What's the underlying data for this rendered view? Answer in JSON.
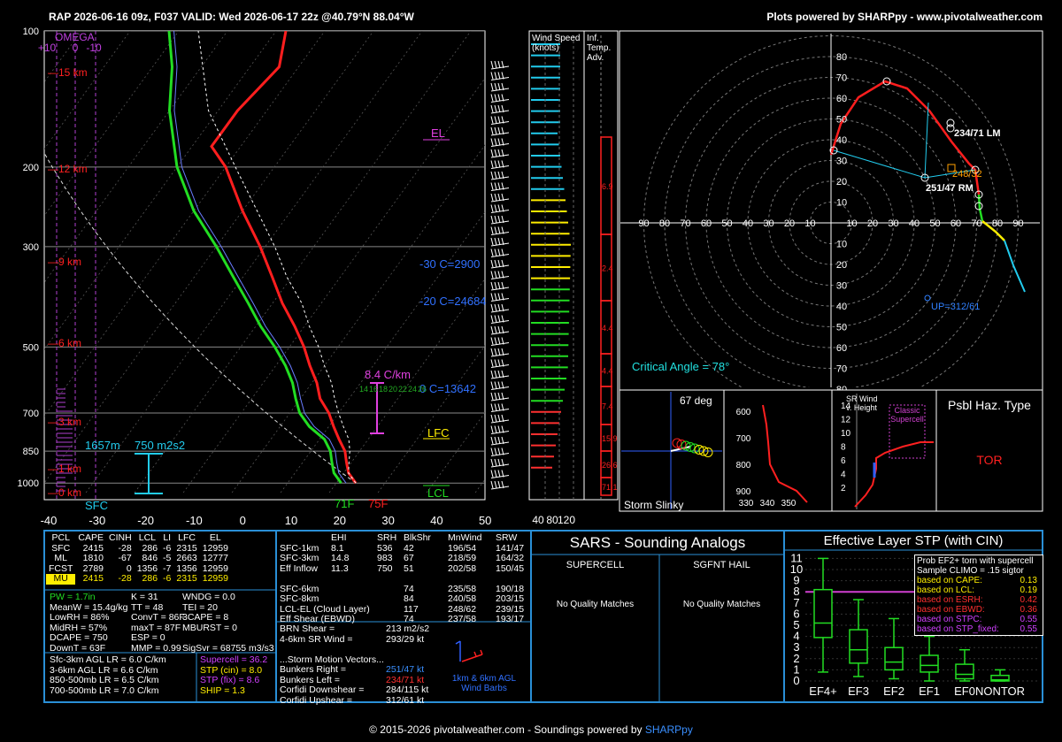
{
  "header": {
    "left": "RAP 2026-06-16 09z, F037  VALID: Wed 2026-06-17 22z @40.79°N 88.04°W",
    "right": "Plots powered by SHARPpy - www.pivotalweather.com"
  },
  "footer": {
    "text": "© 2015-2026 pivotalweather.com - Soundings powered by ",
    "link": "SHARPpy"
  },
  "skewt": {
    "pressure_ticks": [
      "100",
      "200",
      "300",
      "500",
      "700",
      "850",
      "1000"
    ],
    "temp_ticks": [
      "-40",
      "-30",
      "-20",
      "-10",
      "0",
      "10",
      "20",
      "30",
      "40",
      "50"
    ],
    "height_labels": [
      "15 km",
      "12 km",
      "9 km",
      "6 km",
      "3 km",
      "1 km",
      "0 km"
    ],
    "omega_label": "OMEGA",
    "omega_ticks": [
      "+10",
      "0",
      "-10"
    ],
    "el_label": "EL",
    "lfc_label": "LFC",
    "lcl_label": "LCL",
    "lapse_label": "8.4 C/km",
    "hgz_labels": [
      "-30 C=2900",
      "-20 C=24684",
      "0 C=13642"
    ],
    "srh_depth": "1657m",
    "srh_value": "750 m2s2",
    "sfc_label": "SFC",
    "td_sfc": "71F",
    "t_sfc": "75F",
    "wetbulb_ticks": [
      "14",
      "16",
      "18",
      "20",
      "22",
      "24",
      "26"
    ]
  },
  "chart_data": [
    {
      "type": "line",
      "title": "",
      "xlabel": "",
      "ylabel": "",
      "ylim": [
        1000,
        100
      ],
      "xlim": [
        -40,
        50
      ],
      "series": [
        {
          "name": "",
          "color": "#ff1e1e",
          "points": [
            [
              1000,
              24
            ],
            [
              950,
              21
            ],
            [
              900,
              19
            ],
            [
              850,
              17
            ],
            [
              800,
              14
            ],
            [
              750,
              11
            ],
            [
              700,
              8
            ],
            [
              650,
              4
            ],
            [
              600,
              1
            ],
            [
              550,
              -3
            ],
            [
              500,
              -7
            ],
            [
              450,
              -12
            ],
            [
              400,
              -18
            ],
            [
              350,
              -24
            ],
            [
              300,
              -31
            ],
            [
              250,
              -40
            ],
            [
              200,
              -50
            ],
            [
              180,
              -56
            ],
            [
              150,
              -56
            ],
            [
              120,
              -54
            ],
            [
              100,
              -58
            ]
          ]
        },
        {
          "name": "",
          "color": "#22dd22",
          "points": [
            [
              1000,
              21
            ],
            [
              950,
              18
            ],
            [
              900,
              16
            ],
            [
              850,
              14
            ],
            [
              800,
              11
            ],
            [
              750,
              6
            ],
            [
              700,
              2
            ],
            [
              650,
              -1
            ],
            [
              600,
              -4
            ],
            [
              550,
              -8
            ],
            [
              500,
              -13
            ],
            [
              450,
              -19
            ],
            [
              400,
              -25
            ],
            [
              350,
              -32
            ],
            [
              300,
              -40
            ],
            [
              250,
              -50
            ],
            [
              200,
              -60
            ],
            [
              150,
              -70
            ],
            [
              120,
              -76
            ],
            [
              100,
              -82
            ]
          ]
        },
        {
          "name": "",
          "color": "#ffffff",
          "points": [
            [
              1000,
              24
            ],
            [
              950,
              21
            ],
            [
              900,
              19.5
            ],
            [
              850,
              18
            ],
            [
              800,
              16
            ],
            [
              750,
              13
            ],
            [
              700,
              10
            ],
            [
              650,
              7
            ],
            [
              600,
              4
            ],
            [
              550,
              0
            ],
            [
              500,
              -4
            ],
            [
              450,
              -9
            ],
            [
              400,
              -14
            ],
            [
              350,
              -21
            ],
            [
              300,
              -28
            ],
            [
              250,
              -37
            ],
            [
              200,
              -48
            ],
            [
              150,
              -62
            ],
            [
              100,
              -76
            ]
          ]
        }
      ]
    },
    {
      "type": "scatter",
      "title": "",
      "series": [
        {
          "name": "hodograph",
          "color": "#ff1e1e",
          "points": [
            [
              -4,
              2
            ],
            [
              0,
              4
            ],
            [
              4,
              6
            ],
            [
              8,
              10
            ],
            [
              12,
              16
            ],
            [
              20,
              25
            ],
            [
              28,
              32
            ],
            [
              36,
              38
            ],
            [
              46,
              42
            ],
            [
              56,
              42
            ],
            [
              63,
              40
            ],
            [
              66,
              33
            ],
            [
              68,
              27
            ],
            [
              70,
              22
            ],
            [
              70,
              18
            ]
          ]
        }
      ],
      "labels": [
        "234/71 LM",
        "251/47 RM",
        "248/32",
        "UP=312/61"
      ],
      "ring_labels": [
        "10",
        "20",
        "30",
        "40",
        "50",
        "60",
        "70",
        "80",
        "90"
      ],
      "critical_angle": "Critical Angle = 78°"
    }
  ],
  "wind_panel": {
    "title": "Wind Speed (knots)",
    "inf_title": "Inf. Temp. Adv.",
    "speed_ticks": [
      "40",
      "80",
      "120"
    ],
    "adv_labels": [
      "6.9",
      "2.4",
      "4.4",
      "4.4",
      "7.4",
      "15.9",
      "26.6",
      "71.1"
    ]
  },
  "storm_slinky": {
    "title": "Storm Slinky",
    "deg": "67 deg"
  },
  "theta_panel": {
    "p_ticks": [
      "600",
      "700",
      "800",
      "900"
    ],
    "t_ticks": [
      "330",
      "340",
      "350"
    ]
  },
  "srwind_panel": {
    "title": "SR Wind v. Height",
    "label": "Classic Supercell",
    "ticks": [
      "14",
      "12",
      "10",
      "8",
      "6",
      "4",
      "2"
    ]
  },
  "hazard": {
    "title": "Psbl Haz. Type",
    "value": "TOR"
  },
  "params": {
    "headers": [
      "PCL",
      "CAPE",
      "CINH",
      "LCL",
      "LI",
      "LFC",
      "EL"
    ],
    "rows": [
      [
        "SFC",
        "2415",
        "-28",
        "286",
        "-6",
        "2315",
        "12959"
      ],
      [
        "ML",
        "1810",
        "-67",
        "846",
        "-5",
        "2663",
        "12777"
      ],
      [
        "FCST",
        "2789",
        "0",
        "1356",
        "-7",
        "1356",
        "12959"
      ],
      [
        "MU",
        "2415",
        "-28",
        "286",
        "-6",
        "2315",
        "12959"
      ]
    ],
    "lines": [
      [
        "PW = 1.7in",
        "K = 31",
        "WNDG = 0.0"
      ],
      [
        "MeanW = 15.4g/kg",
        "TT = 48",
        "TEI = 20"
      ],
      [
        "LowRH = 86%",
        "ConvT = 86F",
        "3CAPE = 8"
      ],
      [
        "MidRH = 57%",
        "maxT = 87F",
        "MBURST = 0"
      ],
      [
        "DCAPE = 750",
        "ESP = 0",
        ""
      ],
      [
        "DownT = 63F",
        "MMP = 0.99",
        "SigSvr = 68755 m3/s3"
      ]
    ],
    "lapse": [
      "Sfc-3km AGL LR = 6.0 C/km",
      "3-6km AGL LR = 6.6 C/km",
      "850-500mb LR = 6.5 C/km",
      "700-500mb LR = 7.0 C/km"
    ],
    "composites": [
      "Supercell = 36.2",
      "STP (cin) = 8.0",
      "STP (fix) = 8.6",
      "SHIP = 1.3"
    ]
  },
  "kinematics": {
    "headers": [
      "EHI",
      "SRH",
      "BlkShr",
      "MnWind",
      "SRW"
    ],
    "rows": [
      [
        "SFC-1km",
        "8.1",
        "536",
        "42",
        "196/54",
        "141/47"
      ],
      [
        "SFC-3km",
        "14.8",
        "983",
        "67",
        "218/59",
        "164/32"
      ],
      [
        "Eff Inflow",
        "11.3",
        "750",
        "51",
        "202/58",
        "150/45"
      ],
      [
        "",
        "",
        "",
        "",
        "",
        ""
      ],
      [
        "SFC-6km",
        "",
        "",
        "74",
        "235/58",
        "190/18"
      ],
      [
        "SFC-8km",
        "",
        "",
        "84",
        "240/58",
        "203/15"
      ],
      [
        "LCL-EL (Cloud Layer)",
        "",
        "",
        "117",
        "248/62",
        "239/15"
      ],
      [
        "Eff Shear (EBWD)",
        "",
        "",
        "74",
        "237/58",
        "193/17"
      ]
    ],
    "brn": "BRN Shear =",
    "brn_val": "213 m2/s2",
    "srw46": "4-6km SR Wind =",
    "srw46_val": "293/29 kt",
    "motion_title": "...Storm Motion Vectors...",
    "motions": [
      [
        "Bunkers Right =",
        "251/47 kt"
      ],
      [
        "Bunkers Left =",
        "234/71 kt"
      ],
      [
        "Corfidi Downshear =",
        "284/115 kt"
      ],
      [
        "Corfidi Upshear =",
        "312/61 kt"
      ]
    ],
    "barb_caption": "1km & 6km AGL Wind Barbs"
  },
  "sars": {
    "title": "SARS - Sounding Analogs",
    "col1": "SUPERCELL",
    "col2": "SGFNT HAIL",
    "msg1": "No Quality Matches",
    "msg2": "No Quality Matches"
  },
  "stp": {
    "title": "Effective Layer STP (with CIN)",
    "yticks": [
      "11",
      "10",
      "9",
      "8",
      "7",
      "6",
      "5",
      "4",
      "3",
      "2",
      "1",
      "0"
    ],
    "categories": [
      "EF4+",
      "EF3",
      "EF2",
      "EF1",
      "EF0",
      "NONTOR"
    ],
    "value": 8.0,
    "legend": [
      [
        "Prob EF2+ torn with supercell",
        ""
      ],
      [
        "Sample CLIMO = .15 sigtor",
        ""
      ],
      [
        "based on CAPE:",
        "0.13"
      ],
      [
        "based on LCL:",
        "0.19"
      ],
      [
        "based on ESRH:",
        "0.42"
      ],
      [
        "based on EBWD:",
        "0.36"
      ],
      [
        "based on STPC:",
        "0.55"
      ],
      [
        "based on STP_fixed:",
        "0.55"
      ]
    ]
  }
}
